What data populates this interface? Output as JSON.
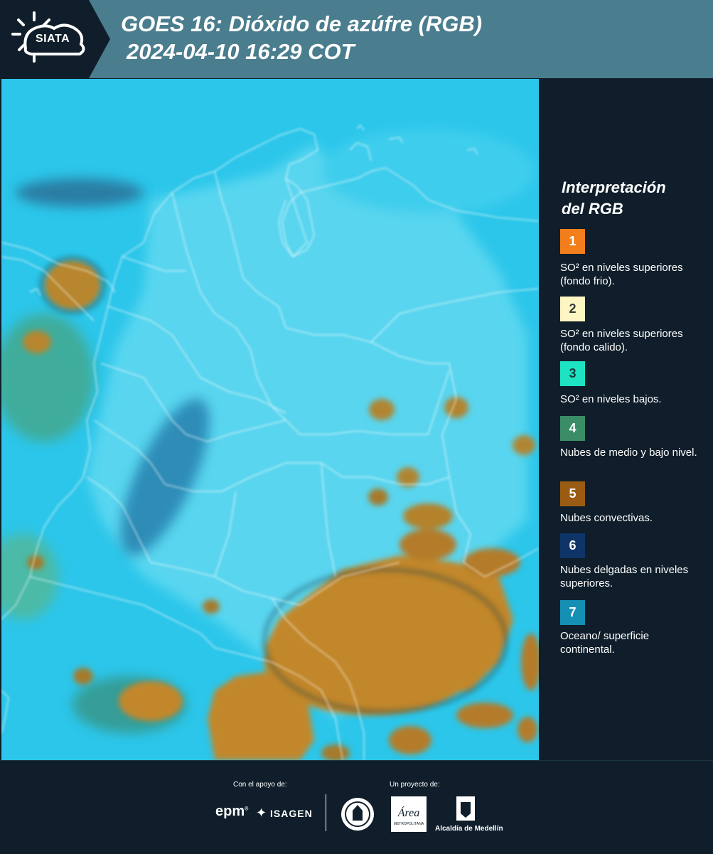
{
  "header": {
    "logo_text": "SIATA",
    "title_line1": "GOES 16: Dióxido de azúfre (RGB)",
    "title_line2": "2024-04-10 16:29 COT"
  },
  "legend": {
    "title_line1": "Interpretación",
    "title_line2": "del RGB",
    "items": [
      {
        "number": "1",
        "color": "#f27f1b",
        "text_color": "#ffffff",
        "label": "SO² en niveles superiores (fondo frio)."
      },
      {
        "number": "2",
        "color": "#fdf6c3",
        "text_color": "#3a3a3a",
        "label": "SO² en niveles superiores (fondo calido)."
      },
      {
        "number": "3",
        "color": "#1de3c2",
        "text_color": "#1a3a3a",
        "label": "SO² en niveles bajos."
      },
      {
        "number": "4",
        "color": "#3a8d66",
        "text_color": "#ffffff",
        "label": "Nubes de medio y bajo nivel."
      },
      {
        "number": "5",
        "color": "#9a5c12",
        "text_color": "#ffffff",
        "label": "Nubes convectivas."
      },
      {
        "number": "6",
        "color": "#0e3468",
        "text_color": "#ffffff",
        "label": "Nubes delgadas en niveles superiores."
      },
      {
        "number": "7",
        "color": "#168fb4",
        "text_color": "#ffffff",
        "label": "Oceano/ superficie continental."
      }
    ]
  },
  "footer": {
    "support_label": "Con el apoyo de:",
    "project_label": "Un proyecto de:",
    "epm": "epm",
    "isagen": "ISAGEN",
    "metro": "Área",
    "metro_sub": "METROPOLITANA",
    "alcaldia": "Alcaldía de Medellín"
  }
}
